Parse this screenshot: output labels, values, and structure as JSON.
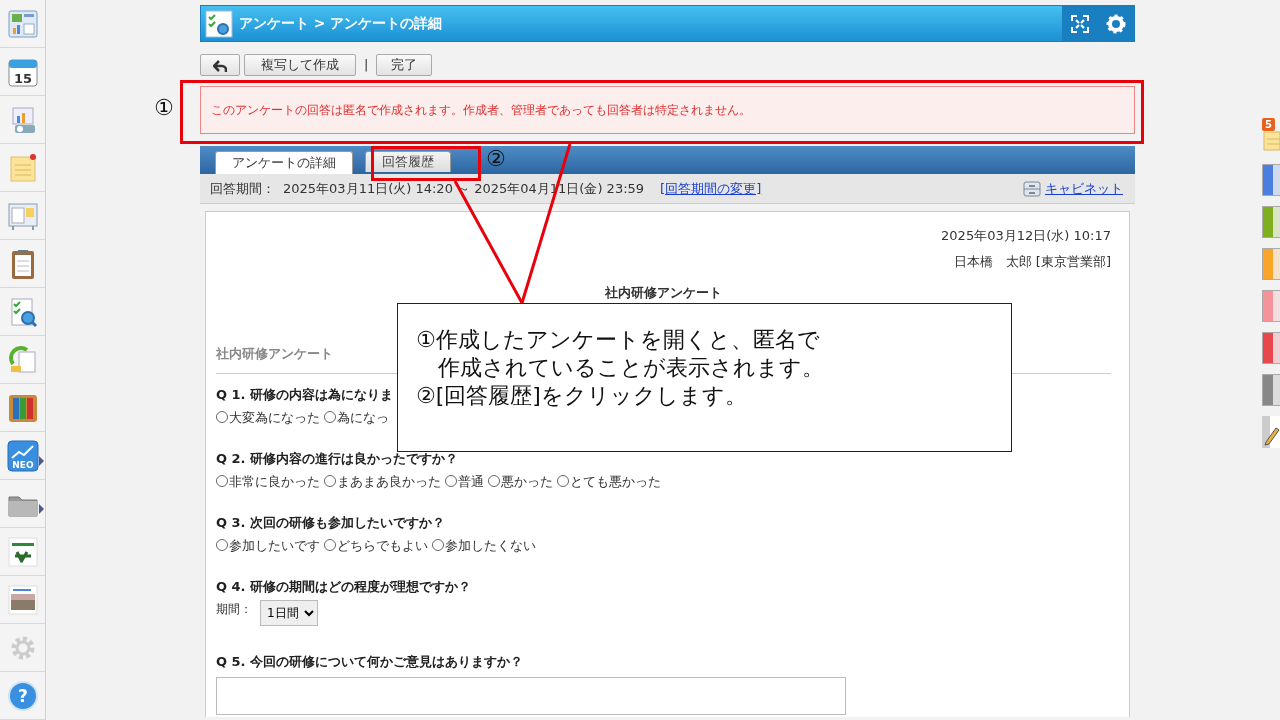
{
  "sidebar": {
    "items": [
      {
        "has_submenu": false
      },
      {
        "has_submenu": false,
        "label": "15"
      },
      {
        "has_submenu": false
      },
      {
        "has_submenu": false
      },
      {
        "has_submenu": false
      },
      {
        "has_submenu": false
      },
      {
        "has_submenu": false
      },
      {
        "has_submenu": false
      },
      {
        "has_submenu": false
      },
      {
        "has_submenu": true,
        "label": "NEO"
      },
      {
        "has_submenu": true
      },
      {
        "has_submenu": false
      },
      {
        "has_submenu": false
      },
      {
        "has_submenu": false
      },
      {
        "has_submenu": false,
        "label": "?"
      }
    ]
  },
  "header": {
    "title": "アンケート > アンケートの詳細"
  },
  "toolbar": {
    "buttons": [
      "複写して作成"
    ],
    "separator": "|",
    "done_button": "完了"
  },
  "notice": "このアンケートの回答は匿名で作成されます。作成者、管理者であっても回答者は特定されません。",
  "tabs": [
    {
      "label": "アンケートの詳細",
      "selected": true
    },
    {
      "label": "回答履歴",
      "selected": false
    }
  ],
  "period": {
    "label": "回答期間：",
    "value": "2025年03月11日(火) 14:20 ～ 2025年04月11日(金) 23:59",
    "change_link": "[回答期間の変更]",
    "cabinet_link": "キャビネット"
  },
  "survey": {
    "date": "2025年03月12日(水) 10:17",
    "author": "日本橋　太郎 [東京営業部]",
    "title": "社内研修アンケート",
    "section": "社内研修アンケート",
    "questions": [
      {
        "kind": "radio",
        "title": "Q 1. 研修の内容は為になりま",
        "options": [
          {
            "label": "大変為になった",
            "selected": false
          },
          {
            "label": "為になっ",
            "selected": false
          }
        ]
      },
      {
        "kind": "radio",
        "title": "Q 2. 研修内容の進行は良かったですか？",
        "options": [
          {
            "label": "非常に良かった",
            "selected": false
          },
          {
            "label": "まあまあ良かった",
            "selected": false
          },
          {
            "label": "普通",
            "selected": false
          },
          {
            "label": "悪かった",
            "selected": false
          },
          {
            "label": "とても悪かった",
            "selected": false
          }
        ]
      },
      {
        "kind": "radio",
        "title": "Q 3. 次回の研修も参加したいですか？",
        "options": [
          {
            "label": "参加したいです",
            "selected": false
          },
          {
            "label": "どちらでもよい",
            "selected": false
          },
          {
            "label": "参加したくない",
            "selected": false
          }
        ]
      },
      {
        "kind": "select",
        "title": "Q 4. 研修の期間はどの程度が理想ですか？",
        "label": "期間：",
        "value": "1日間"
      },
      {
        "kind": "textarea",
        "title": "Q 5. 今回の研修について何かご意見はありますか？"
      }
    ]
  },
  "right_strip": {
    "memo_badge": "5",
    "tabs": [
      {
        "color": "#4a7fe0"
      },
      {
        "color": "#7fae1f"
      },
      {
        "color": "#f8a52a"
      },
      {
        "color": "#f5939b"
      },
      {
        "color": "#e8474e"
      },
      {
        "color": "#888888"
      }
    ]
  },
  "annotation": {
    "markers": [
      "①",
      "②"
    ],
    "callout": [
      "①作成したアンケートを開くと、匿名で",
      "　作成されていることが表示されます。",
      "②[回答履歴]をクリックします。"
    ]
  }
}
